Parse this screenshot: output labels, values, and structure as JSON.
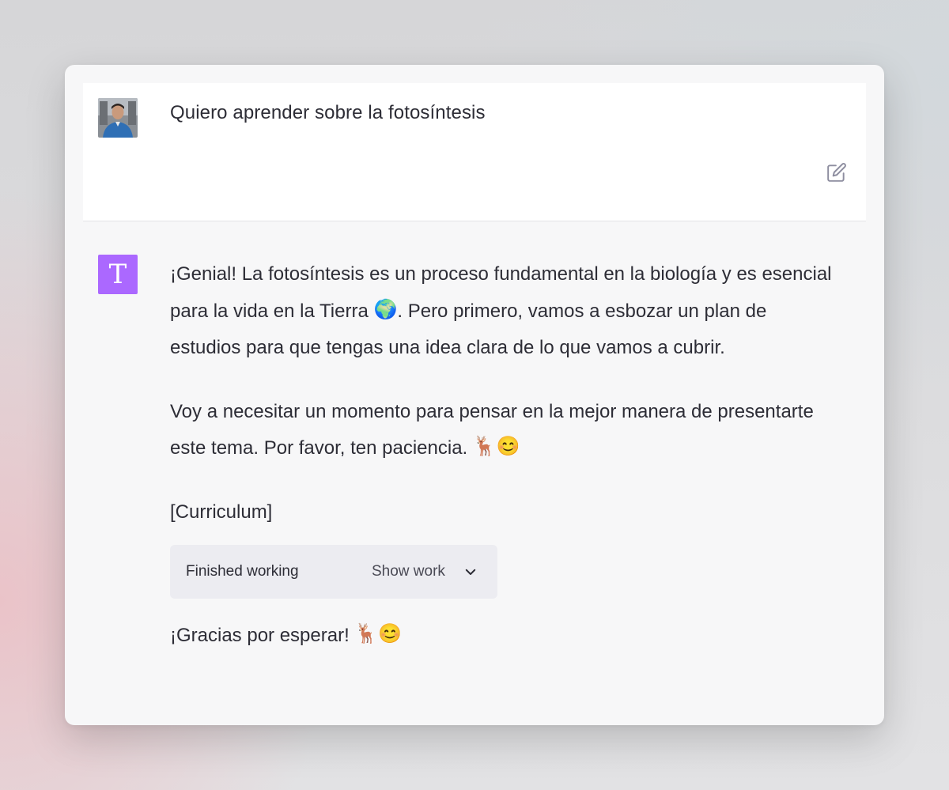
{
  "user": {
    "message": "Quiero aprender sobre la fotosíntesis",
    "avatar_icon": "user-photo-avatar",
    "edit_icon": "edit-icon"
  },
  "assistant": {
    "avatar_letter": "T",
    "avatar_color": "#ab68ff",
    "p1_before_emoji": "¡Genial! La fotosíntesis es un proceso fundamental en la biología y es esencial para la vida en la Tierra ",
    "p1_emoji": "🌍",
    "p1_after_emoji": ". Pero primero, vamos a esbozar un plan de estudios para que tengas una idea clara de lo que vamos a cubrir.",
    "p2_text": "Voy a necesitar un momento para pensar en la mejor manera de presentarte este tema. Por favor, ten paciencia. ",
    "p2_emojis": "🦌😊",
    "placeholder": "[Curriculum]",
    "work_status": "Finished working",
    "show_work_label": "Show work",
    "p3_text": "¡Gracias por esperar! ",
    "p3_emojis": "🦌😊"
  }
}
